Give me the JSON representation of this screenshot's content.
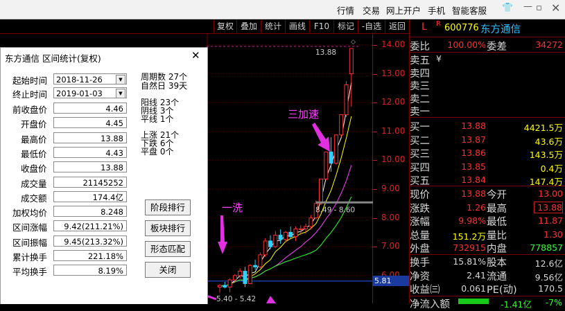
{
  "topmenu": {
    "items": [
      "行情",
      "交易",
      "网上开户",
      "手机",
      "智能客服"
    ],
    "icons": [
      "shirt-icon",
      "minimize-icon",
      "maximize-icon",
      "close-icon"
    ]
  },
  "toolbar": {
    "buttons": [
      "复权",
      "叠加",
      "统计",
      "画线",
      "F10",
      "标记",
      "-自选",
      "返回"
    ]
  },
  "dialog": {
    "title": "东方通信 区间统计(复权)",
    "close": "✕",
    "start_label": "起始时间",
    "start_value": "2018-11-26",
    "end_label": "终止时间",
    "end_value": "2019-01-03",
    "rows": [
      {
        "label": "前收盘价",
        "value": "4.46"
      },
      {
        "label": "开盘价",
        "value": "4.45"
      },
      {
        "label": "最高价",
        "value": "13.88"
      },
      {
        "label": "最低价",
        "value": "4.43"
      },
      {
        "label": "收盘价",
        "value": "13.88"
      },
      {
        "label": "成交量",
        "value": "21145252"
      },
      {
        "label": "成交额",
        "value": "174.4亿"
      },
      {
        "label": "加权均价",
        "value": "8.248"
      },
      {
        "label": "区间涨幅",
        "value": "9.42(211.21%)"
      },
      {
        "label": "区间振幅",
        "value": "9.45(213.32%)"
      },
      {
        "label": "累计换手",
        "value": "221.18%"
      },
      {
        "label": "平均换手",
        "value": "8.19%"
      }
    ],
    "stats": {
      "period_count": "周期数 27个",
      "natural_days": "自然日 39天",
      "yang": "阳线 23个",
      "yin": "阴线 3个",
      "flat_line": "平线 1个",
      "up": "上涨 21个",
      "down": "下跌 6个",
      "flat": "平盘 0个"
    },
    "buttons": [
      "阶段排行",
      "板块排行",
      "形态匹配",
      "关闭"
    ]
  },
  "chart": {
    "annotations": {
      "wash": "一洗",
      "accel": "三加速"
    },
    "high_label": "13.88",
    "range_label_1": "8.49 - 8.60",
    "range_label_2": "5.40 - 5.42",
    "price_marker": "5.81",
    "yaxis": [
      "14.00",
      "13.00",
      "12.00",
      "11.00",
      "10.00",
      "9.00",
      "8.00",
      "7.00",
      "6.00"
    ]
  },
  "panel": {
    "marker_l": "L",
    "marker_r": "R",
    "code": "600776",
    "name": "东方通信",
    "weibi_label": "委比",
    "weibi_value": "100.00%",
    "weicha_label": "委差",
    "weicha_value": "34272",
    "sells": [
      {
        "label": "卖五",
        "price": "¥"
      },
      {
        "label": "卖四",
        "price": ""
      },
      {
        "label": "卖三",
        "price": ""
      },
      {
        "label": "卖二",
        "price": ""
      },
      {
        "label": "卖一",
        "price": ""
      }
    ],
    "buys": [
      {
        "label": "买一",
        "price": "13.88",
        "vol": "4421.5万"
      },
      {
        "label": "买二",
        "price": "13.87",
        "vol": "43.6万"
      },
      {
        "label": "买三",
        "price": "13.86",
        "vol": "143.5万"
      },
      {
        "label": "买四",
        "price": "13.85",
        "vol": "0.4万"
      },
      {
        "label": "买五",
        "price": "13.84",
        "vol": "147.4万"
      }
    ],
    "quote": [
      {
        "l1": "现价",
        "v1": "13.88",
        "l2": "今开",
        "v2": "13.00",
        "c1": "#ff3030",
        "c2": "#ff3030"
      },
      {
        "l1": "涨跌",
        "v1": "1.26",
        "l2": "最高",
        "v2": "13.88",
        "c1": "#ff3030",
        "c2": "#ff3030"
      },
      {
        "l1": "涨幅",
        "v1": "9.98%",
        "l2": "最低",
        "v2": "11.87",
        "c1": "#ff3030",
        "c2": "#ff3030"
      },
      {
        "l1": "总量",
        "v1": "151.2万",
        "l2": "量比",
        "v2": "1.30",
        "c1": "#ffff00",
        "c2": "#ff3030"
      },
      {
        "l1": "外盘",
        "v1": "732915",
        "l2": "内盘",
        "v2": "778857",
        "c1": "#ff3030",
        "c2": "#30ff30"
      }
    ],
    "stats": [
      {
        "l1": "换手",
        "v1": "15.81%",
        "l2": "股本",
        "v2": "12.6亿"
      },
      {
        "l1": "净资",
        "v1": "2.41",
        "l2": "流通",
        "v2": "9.56亿"
      },
      {
        "l1": "收益㈢",
        "v1": "0.061",
        "l2": "PE(动)",
        "v2": "170.5"
      }
    ],
    "net_inflow_label": "净流入额",
    "net_inflow_value": "-1.41亿",
    "net_inflow_pct": "-7%"
  },
  "candles": [
    {
      "o": 5.6,
      "h": 5.7,
      "l": 5.4,
      "c": 5.66
    },
    {
      "o": 5.66,
      "h": 5.78,
      "l": 5.55,
      "c": 5.6
    },
    {
      "o": 5.6,
      "h": 5.9,
      "l": 5.42,
      "c": 5.85
    },
    {
      "o": 5.85,
      "h": 6.05,
      "l": 5.75,
      "c": 6.0
    },
    {
      "o": 6.0,
      "h": 6.25,
      "l": 5.9,
      "c": 6.15
    },
    {
      "o": 6.15,
      "h": 6.3,
      "l": 5.6,
      "c": 5.72
    },
    {
      "o": 5.72,
      "h": 6.4,
      "l": 5.7,
      "c": 6.35
    },
    {
      "o": 6.35,
      "h": 6.55,
      "l": 6.2,
      "c": 6.3
    },
    {
      "o": 6.3,
      "h": 6.8,
      "l": 6.25,
      "c": 6.72
    },
    {
      "o": 6.72,
      "h": 7.3,
      "l": 6.65,
      "c": 7.2
    },
    {
      "o": 7.2,
      "h": 7.4,
      "l": 6.9,
      "c": 7.0
    },
    {
      "o": 7.0,
      "h": 7.55,
      "l": 6.95,
      "c": 7.4
    },
    {
      "o": 7.4,
      "h": 7.6,
      "l": 7.1,
      "c": 7.25
    },
    {
      "o": 7.25,
      "h": 7.55,
      "l": 7.15,
      "c": 7.5
    },
    {
      "o": 7.5,
      "h": 7.7,
      "l": 7.3,
      "c": 7.35
    },
    {
      "o": 7.35,
      "h": 7.7,
      "l": 7.2,
      "c": 7.62
    },
    {
      "o": 7.62,
      "h": 7.75,
      "l": 7.4,
      "c": 7.62
    },
    {
      "o": 7.62,
      "h": 7.8,
      "l": 7.45,
      "c": 7.7
    },
    {
      "o": 7.7,
      "h": 8.1,
      "l": 7.6,
      "c": 8.0
    },
    {
      "o": 8.0,
      "h": 8.6,
      "l": 7.95,
      "c": 8.5
    },
    {
      "o": 8.5,
      "h": 9.35,
      "l": 8.45,
      "c": 9.35
    },
    {
      "o": 9.35,
      "h": 10.3,
      "l": 9.3,
      "c": 10.29
    },
    {
      "o": 10.29,
      "h": 10.8,
      "l": 9.6,
      "c": 9.9
    },
    {
      "o": 9.9,
      "h": 10.9,
      "l": 9.85,
      "c": 10.88
    },
    {
      "o": 10.88,
      "h": 11.6,
      "l": 10.8,
      "c": 11.58
    },
    {
      "o": 11.58,
      "h": 12.75,
      "l": 11.5,
      "c": 12.62
    },
    {
      "o": 13.0,
      "h": 13.88,
      "l": 11.87,
      "c": 13.88
    }
  ]
}
